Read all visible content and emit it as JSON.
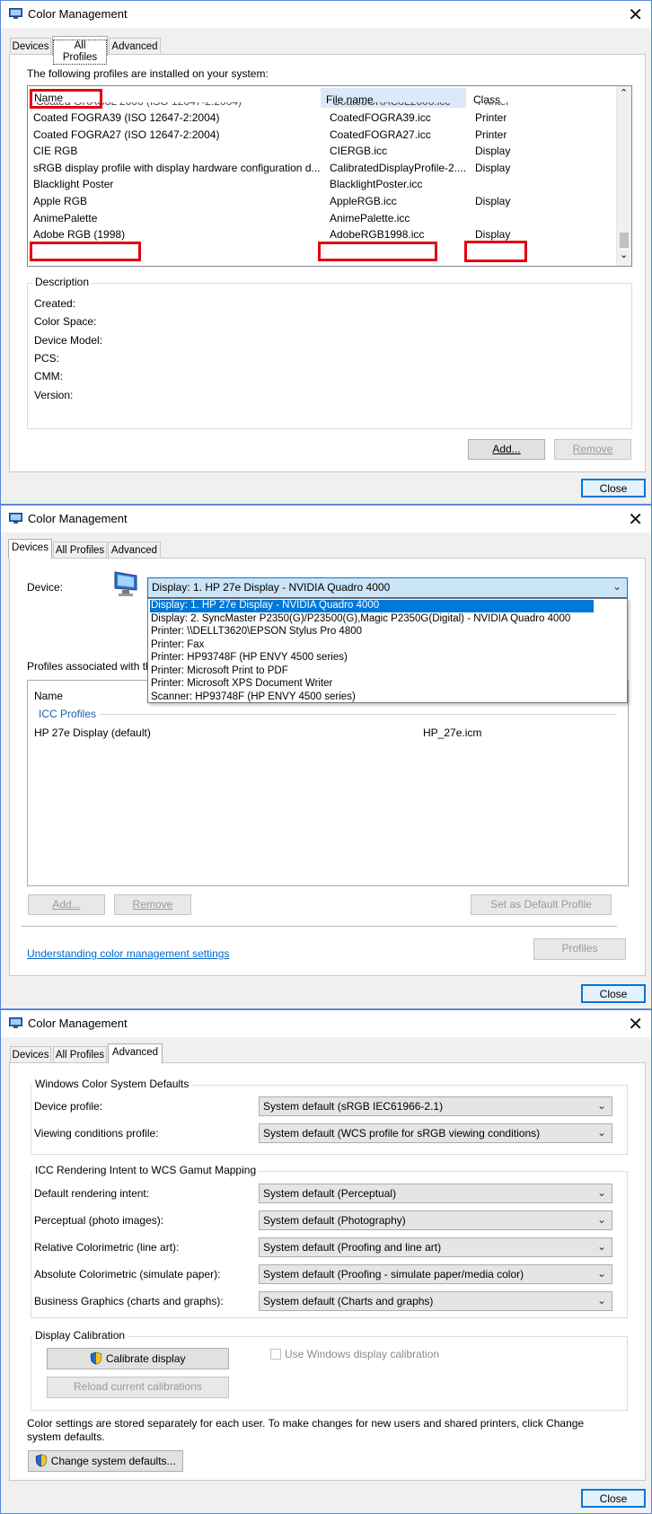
{
  "windows": [
    {
      "title": "Color Management",
      "tabs": [
        "Devices",
        "All Profiles",
        "Advanced"
      ],
      "all_profiles": {
        "intro": "The following profiles are installed on your system:",
        "columns": [
          "Name",
          "File name",
          "Class"
        ],
        "rows": [
          {
            "name": "Coated FOGRA39 (ISO 12647-2:2004)",
            "file": "CoatedFOGRA39.icc",
            "cls": "Printer"
          },
          {
            "name": "Coated FOGRA27 (ISO 12647-2:2004)",
            "file": "CoatedFOGRA27.icc",
            "cls": "Printer"
          },
          {
            "name": "CIE RGB",
            "file": "CIERGB.icc",
            "cls": "Display"
          },
          {
            "name": "sRGB display profile with display hardware configuration d...",
            "file": "CalibratedDisplayProfile-2....",
            "cls": "Display"
          },
          {
            "name": "Blacklight Poster",
            "file": "BlacklightPoster.icc",
            "cls": ""
          },
          {
            "name": "Apple RGB",
            "file": "AppleRGB.icc",
            "cls": "Display"
          },
          {
            "name": "AnimePalette",
            "file": "AnimePalette.icc",
            "cls": ""
          },
          {
            "name": "Adobe RGB (1998)",
            "file": "AdobeRGB1998.icc",
            "cls": "Display"
          }
        ],
        "description_title": "Description",
        "description_fields": [
          "Created:",
          "Color Space:",
          "Device Model:",
          "PCS:",
          "CMM:",
          "Version:"
        ],
        "add_label": "Add...",
        "remove_label": "Remove"
      },
      "close_label": "Close"
    },
    {
      "title": "Color Management",
      "tabs": [
        "Devices",
        "All Profiles",
        "Advanced"
      ],
      "devices": {
        "device_label": "Device:",
        "selected_device": "Display: 1. HP 27e Display - NVIDIA Quadro 4000",
        "dropdown_options": [
          "Display: 1. HP 27e Display - NVIDIA Quadro 4000",
          "Display: 2. SyncMaster P2350(G)/P23500(G),Magic P2350G(Digital) - NVIDIA Quadro 4000",
          "Printer: \\\\DELLT3620\\EPSON Stylus Pro 4800",
          "Printer: Fax",
          "Printer: HP93748F (HP ENVY 4500 series)",
          "Printer: Microsoft Print to PDF",
          "Printer: Microsoft XPS Document Writer",
          "Scanner: HP93748F (HP ENVY 4500 series)"
        ],
        "profiles_assoc_label": "Profiles associated with th",
        "name_column": "Name",
        "icc_profiles_label": "ICC Profiles",
        "profile_name": "HP 27e Display (default)",
        "profile_file": "HP_27e.icm",
        "add_label": "Add...",
        "remove_label": "Remove",
        "set_default_label": "Set as Default Profile",
        "understanding_link": "Understanding color management settings",
        "profiles_button": "Profiles"
      },
      "close_label": "Close"
    },
    {
      "title": "Color Management",
      "tabs": [
        "Devices",
        "All Profiles",
        "Advanced"
      ],
      "advanced": {
        "wcs_group": "Windows Color System Defaults",
        "wcs_rows": [
          {
            "label": "Device profile:",
            "value": "System default (sRGB IEC61966-2.1)"
          },
          {
            "label": "Viewing conditions profile:",
            "value": "System default (WCS profile for sRGB viewing conditions)"
          }
        ],
        "icc_group": "ICC Rendering Intent to WCS Gamut Mapping",
        "icc_rows": [
          {
            "label": "Default rendering intent:",
            "value": "System default (Perceptual)"
          },
          {
            "label": "Perceptual (photo images):",
            "value": "System default (Photography)"
          },
          {
            "label": "Relative Colorimetric (line art):",
            "value": "System default (Proofing and line art)"
          },
          {
            "label": "Absolute Colorimetric (simulate paper):",
            "value": "System default (Proofing - simulate paper/media color)"
          },
          {
            "label": "Business Graphics (charts and graphs):",
            "value": "System default (Charts and graphs)"
          }
        ],
        "calibration_group": "Display Calibration",
        "calibrate_label": "Calibrate display",
        "use_windows_calibration": "Use Windows display calibration",
        "reload_label": "Reload current calibrations",
        "footer_text": "Color settings are stored separately for each user. To make changes for new users and shared printers, click Change system defaults.",
        "change_defaults_label": "Change system defaults..."
      },
      "close_label": "Close"
    }
  ],
  "colors": {
    "accent": "#0078d7",
    "highlight_red": "#e1000f",
    "link": "#0066cc",
    "window_border": "#5b8ad6"
  }
}
